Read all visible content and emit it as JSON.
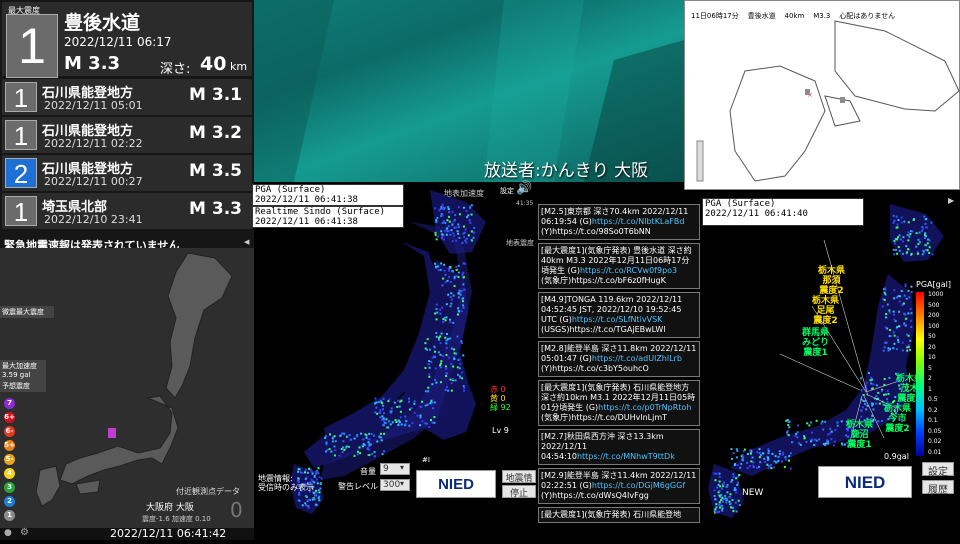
{
  "left_panel": {
    "max_intensity_label": "最大震度",
    "main_event": {
      "intensity": "1",
      "region": "豊後水道",
      "time": "2022/12/11  06:17",
      "magnitude": "M 3.3",
      "depth_label": "深さ:",
      "depth_value": "40",
      "depth_unit": "km"
    },
    "events": [
      {
        "intensity": "1",
        "region": "石川県能登地方",
        "time": "2022/12/11  05:01",
        "magnitude": "M 3.1",
        "color": "#6b6b6b"
      },
      {
        "intensity": "1",
        "region": "石川県能登地方",
        "time": "2022/12/11  02:22",
        "magnitude": "M 3.2",
        "color": "#6b6b6b"
      },
      {
        "intensity": "2",
        "region": "石川県能登地方",
        "time": "2022/12/11  00:27",
        "magnitude": "M 3.5",
        "color": "#1e6fd6"
      },
      {
        "intensity": "1",
        "region": "埼玉県北部",
        "time": "2022/12/10  23:41",
        "magnitude": "M 3.3",
        "color": "#6b6b6b"
      }
    ],
    "warning": "緊急地震速報は発表されていません",
    "labels": {
      "micro": "微震最大震度",
      "max_accel": "最大加速度",
      "accel_value": "3.59 gal",
      "forecast": "予想震度"
    },
    "scale": [
      "7",
      "6+",
      "6-",
      "5+",
      "5-",
      "4",
      "3",
      "2",
      "1"
    ],
    "scale_colors": [
      "#8b2bd1",
      "#d1121c",
      "#e63a1c",
      "#e8801a",
      "#e8a51a",
      "#f5d21a",
      "#27a53a",
      "#1b7fd6",
      "#8c8c8c"
    ],
    "station": {
      "title": "付近観測点データ",
      "name": "大阪府 大阪",
      "intensity_text": "震度-1.6  加速度 0.10",
      "value": "0"
    },
    "clock": "2022/12/11 06:41:42"
  },
  "broadcast": "放送者:かんきり  大阪",
  "top_right": {
    "header": "11日06時17分    豊後水道    40km    M3.3    心配はありません"
  },
  "center": {
    "pga_label": "PGA (Surface)",
    "pga_time": "2022/12/11 06:41:38",
    "sindo_label": "Realtime Sindo (Surface)",
    "sindo_time": "2022/12/11 06:41:38",
    "top_label_1": "地表加速度",
    "top_label_2": "地表震度",
    "settings": "設定",
    "time_small": "41:35",
    "counts": {
      "red": "赤 0",
      "yellow": "黄 0",
      "green": "緑 92"
    },
    "level": "Lv 9",
    "info": "地震情報:\n受信時のみ表示",
    "volume_label": "音量",
    "volume_value": "9",
    "alert_label": "警告レベル",
    "alert_value": "300",
    "nied": "NIED",
    "eq_info_btn": "地震情報",
    "stop_btn": "停止"
  },
  "tweets": [
    {
      "text": "[M2.5]東京都 深さ70.4km 2022/12/11 06:19:54 (G)",
      "link": "https://t.co/NlbtKLaFBd",
      "tail": "(Y)https://t.co/98So0T6bNN"
    },
    {
      "text": "[最大震度1](気象庁発表) 豊後水道 深さ約40km M3.3 2022年12月11日06時17分頃発生 (G)",
      "link": "https://t.co/RCVw0f9po3",
      "tail": "(気象庁)https://t.co/bF6z0fHugK"
    },
    {
      "text": "[M4.9]TONGA 119.6km 2022/12/11 04:52:45 JST, 2022/12/10 19:52:45 UTC (G)",
      "link": "https://t.co/SLfNtivVSK",
      "tail": "(USGS)https://t.co/TGAjEBwLWl"
    },
    {
      "text": "[M2.8]能登半島 深さ11.8km 2022/12/11 05:01:47 (G)",
      "link": "https://t.co/adUlZhlLrb",
      "tail": "(Y)https://t.co/c3bY5ouhcO"
    },
    {
      "text": "[最大震度1](気象庁発表) 石川県能登地方 深さ約10km M3.1 2022年12月11日05時01分頃発生 (G)",
      "link": "https://t.co/p0TrNpRtoh",
      "tail": "(気象庁)https://t.co/DUHvlnLjmT"
    },
    {
      "text": "[M2.7]秋田県西方沖 深さ13.3km 2022/12/11 04:54:10",
      "link": "https://t.co/MNhwT9ttDk",
      "tail": ""
    },
    {
      "text": "[M2.9]能登半島 深さ11.4km 2022/12/11 02:22:51 (G)",
      "link": "https://t.co/DGjM6gGGf",
      "tail": "(Y)https://t.co/dWsQ4IvFgg"
    },
    {
      "text": "[最大震度1](気象庁発表) 石川県能登地",
      "link": "",
      "tail": ""
    }
  ],
  "right": {
    "pga_label": "PGA (Surface)",
    "pga_time": "2022/12/11 06:41:40",
    "legend_title": "PGA[gal]",
    "legend_values": [
      "1000",
      "500",
      "200",
      "100",
      "50",
      "20",
      "10",
      "5",
      "2",
      "1",
      "0.5",
      "0.2",
      "0.1",
      "0.05",
      "0.02",
      "0.01"
    ],
    "labels": {
      "tochigi_nasu": "栃木県\n那須\n震度2",
      "tochigi_sano": "栃木県\n足尾\n震度2",
      "gunma": "群馬県\nみどり\n震度1",
      "tochigi_nishi": "栃木県\n茂木\n震度2",
      "tochigi_imaichi": "栃木県\n今市\n震度2",
      "tochigi_kanuma": "栃木県\n鹿沼\n震度1"
    },
    "gal": "0.9gal",
    "new": "NEW",
    "nied": "NIED",
    "settings_btn": "設定",
    "history_btn": "履歴"
  }
}
